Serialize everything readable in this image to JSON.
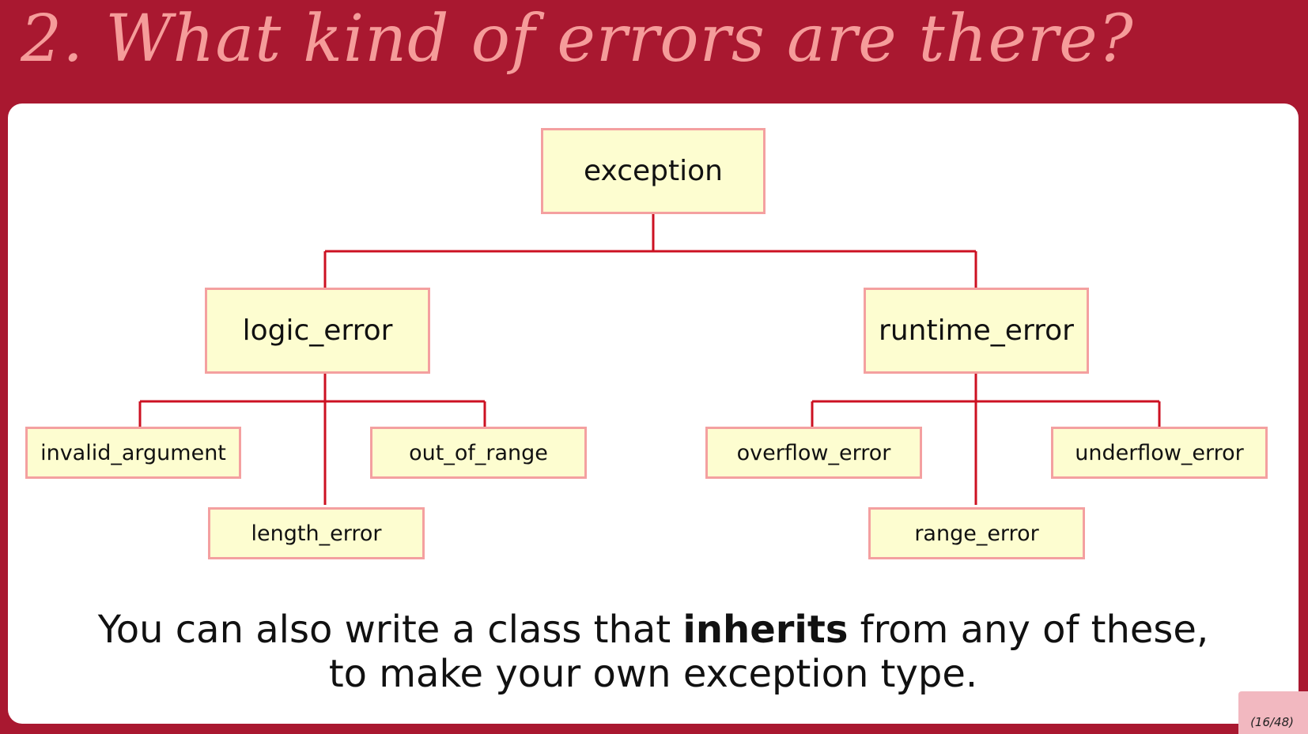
{
  "slide": {
    "title": "2. What kind of errors are there?",
    "page_number": "(16/48)"
  },
  "diagram": {
    "root": "exception",
    "logic_error": "logic_error",
    "runtime_error": "runtime_error",
    "invalid_argument": "invalid_argument",
    "out_of_range": "out_of_range",
    "length_error": "length_error",
    "overflow_error": "overflow_error",
    "underflow_error": "underflow_error",
    "range_error": "range_error"
  },
  "caption": {
    "line1_before": "You can also write a class that ",
    "line1_bold": "inherits",
    "line1_after": " from any of these,",
    "line2": "to make your own exception type."
  },
  "colors": {
    "background": "#a91830",
    "title": "#f59c9a",
    "node_fill": "#fdfdd0",
    "node_border": "#f4a0a0",
    "connector": "#cc1122"
  }
}
